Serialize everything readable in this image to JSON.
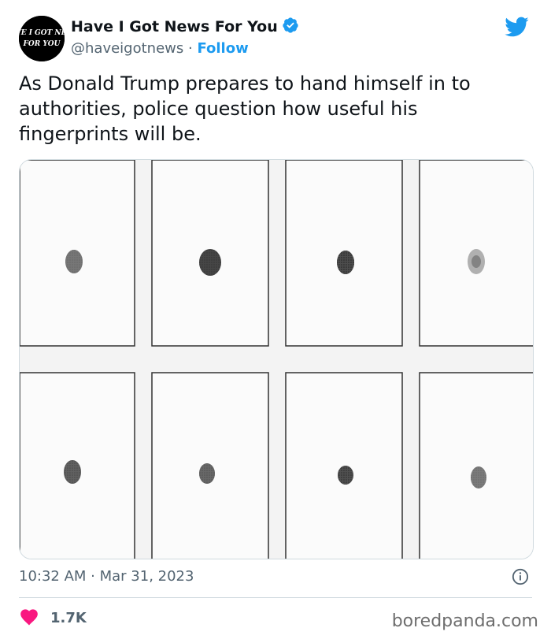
{
  "author": {
    "display_name": "Have I Got News For You",
    "handle": "@haveigotnews",
    "separator": "·",
    "follow_label": "Follow",
    "avatar_text_line1": "HAVE I GOT NEWS",
    "avatar_text_line2": "FOR YOU",
    "verified_color": "#1d9bf0"
  },
  "tweet": {
    "text": "As Donald Trump prepares to hand himself in to authorities, police question how useful his fingerprints will be.",
    "media_description": "grid of 8 fingerprint cards",
    "timestamp": "10:32 AM · Mar 31, 2023"
  },
  "engagement": {
    "likes": "1.7K",
    "like_icon_color": "#f91880"
  },
  "watermark": "boredpanda.com",
  "icons": [
    "verified-badge-icon",
    "twitter-bird-icon",
    "info-icon",
    "heart-icon"
  ]
}
